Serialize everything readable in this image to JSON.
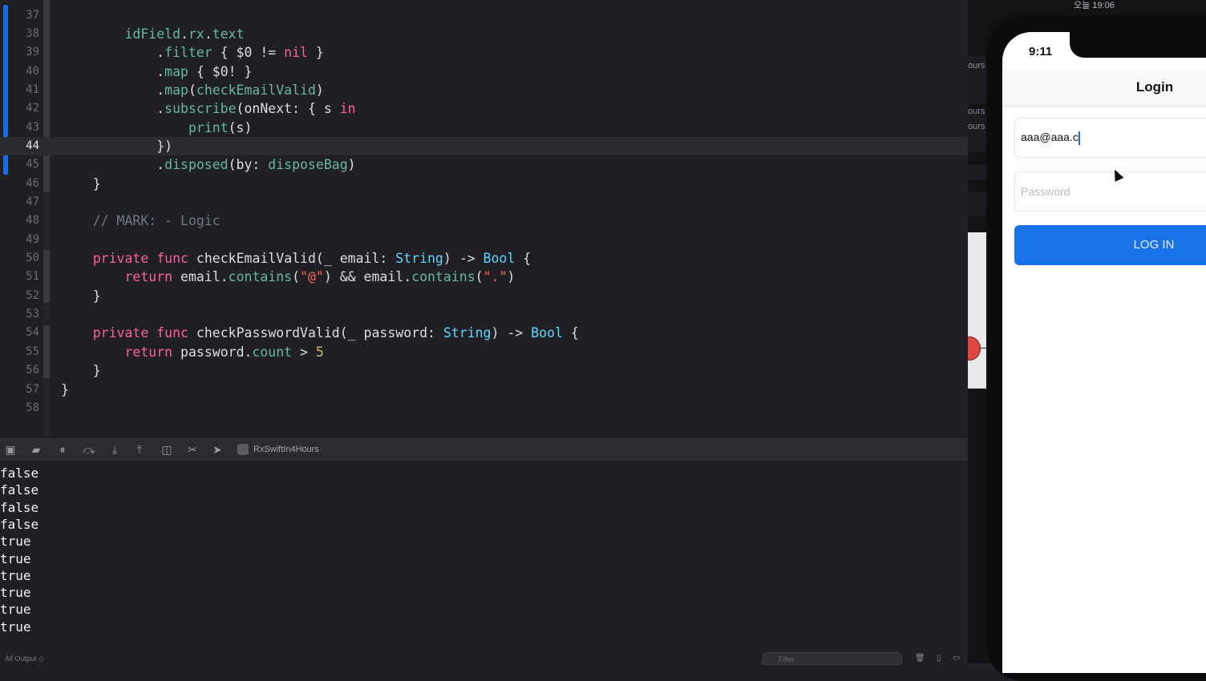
{
  "editor": {
    "lines": [
      {
        "n": "37",
        "tokens": []
      },
      {
        "n": "38",
        "tokens": [
          {
            "t": "        "
          },
          {
            "c": "prop",
            "t": "idField"
          },
          {
            "t": "."
          },
          {
            "c": "prop",
            "t": "rx"
          },
          {
            "t": "."
          },
          {
            "c": "prop",
            "t": "text"
          }
        ]
      },
      {
        "n": "39",
        "tokens": [
          {
            "t": "            ."
          },
          {
            "c": "fn",
            "t": "filter"
          },
          {
            "t": " { $0 != "
          },
          {
            "c": "kw",
            "t": "nil"
          },
          {
            "t": " }"
          }
        ]
      },
      {
        "n": "40",
        "tokens": [
          {
            "t": "            ."
          },
          {
            "c": "fn",
            "t": "map"
          },
          {
            "t": " { $0! }"
          }
        ]
      },
      {
        "n": "41",
        "tokens": [
          {
            "t": "            ."
          },
          {
            "c": "fn",
            "t": "map"
          },
          {
            "t": "("
          },
          {
            "c": "fn",
            "t": "checkEmailValid"
          },
          {
            "t": ")"
          }
        ]
      },
      {
        "n": "42",
        "tokens": [
          {
            "t": "            ."
          },
          {
            "c": "fn",
            "t": "subscribe"
          },
          {
            "t": "(onNext: { s "
          },
          {
            "c": "kw",
            "t": "in"
          }
        ]
      },
      {
        "n": "43",
        "tokens": [
          {
            "t": "                "
          },
          {
            "c": "fn",
            "t": "print"
          },
          {
            "t": "(s)"
          }
        ]
      },
      {
        "n": "44",
        "current": true,
        "tokens": [
          {
            "t": "            })"
          }
        ]
      },
      {
        "n": "45",
        "tokens": [
          {
            "t": "            ."
          },
          {
            "c": "fn",
            "t": "disposed"
          },
          {
            "t": "(by: "
          },
          {
            "c": "prop",
            "t": "disposeBag"
          },
          {
            "t": ")"
          }
        ]
      },
      {
        "n": "46",
        "tokens": [
          {
            "t": "    }"
          }
        ]
      },
      {
        "n": "47",
        "tokens": []
      },
      {
        "n": "48",
        "tokens": [
          {
            "t": "    "
          },
          {
            "c": "cmt",
            "t": "// MARK: - Logic"
          }
        ]
      },
      {
        "n": "49",
        "tokens": []
      },
      {
        "n": "50",
        "tokens": [
          {
            "t": "    "
          },
          {
            "c": "kw",
            "t": "private"
          },
          {
            "t": " "
          },
          {
            "c": "kw",
            "t": "func"
          },
          {
            "t": " checkEmailValid(_ email: "
          },
          {
            "c": "ty",
            "t": "String"
          },
          {
            "t": ") -> "
          },
          {
            "c": "ty",
            "t": "Bool"
          },
          {
            "t": " {"
          }
        ]
      },
      {
        "n": "51",
        "tokens": [
          {
            "t": "        "
          },
          {
            "c": "kw",
            "t": "return"
          },
          {
            "t": " email."
          },
          {
            "c": "fn",
            "t": "contains"
          },
          {
            "t": "("
          },
          {
            "c": "str",
            "t": "\"@\""
          },
          {
            "t": ") && email."
          },
          {
            "c": "fn",
            "t": "contains"
          },
          {
            "t": "("
          },
          {
            "c": "str",
            "t": "\".\""
          },
          {
            "t": ")"
          }
        ]
      },
      {
        "n": "52",
        "tokens": [
          {
            "t": "    }"
          }
        ]
      },
      {
        "n": "53",
        "tokens": []
      },
      {
        "n": "54",
        "tokens": [
          {
            "t": "    "
          },
          {
            "c": "kw",
            "t": "private"
          },
          {
            "t": " "
          },
          {
            "c": "kw",
            "t": "func"
          },
          {
            "t": " checkPasswordValid(_ password: "
          },
          {
            "c": "ty",
            "t": "String"
          },
          {
            "t": ") -> "
          },
          {
            "c": "ty",
            "t": "Bool"
          },
          {
            "t": " {"
          }
        ]
      },
      {
        "n": "55",
        "tokens": [
          {
            "t": "        "
          },
          {
            "c": "kw",
            "t": "return"
          },
          {
            "t": " password."
          },
          {
            "c": "prop",
            "t": "count"
          },
          {
            "t": " > "
          },
          {
            "c": "num",
            "t": "5"
          }
        ]
      },
      {
        "n": "56",
        "tokens": [
          {
            "t": "    }"
          }
        ]
      },
      {
        "n": "57",
        "tokens": [
          {
            "t": "}"
          }
        ]
      },
      {
        "n": "58",
        "tokens": []
      }
    ]
  },
  "debug": {
    "scheme": "RxSwiftIn4Hours"
  },
  "console": {
    "output": [
      "false",
      "false",
      "false",
      "false",
      "true",
      "true",
      "true",
      "true",
      "true",
      "true"
    ],
    "footer_label": "All Output ◇",
    "filter_placeholder": "Filter"
  },
  "background": {
    "clock": "오늘 19:06",
    "snippets": [
      "ours",
      "ours",
      "ours"
    ]
  },
  "simulator": {
    "time": "9:11",
    "nav_title": "Login",
    "email_value": "aaa@aaa.c",
    "password_placeholder": "Password",
    "login_button": "LOG IN"
  },
  "colors": {
    "keyword": "#fc5fa3",
    "function": "#67b7a4",
    "type": "#5dd8ff",
    "string": "#fc6a5d",
    "number": "#d0bf69",
    "comment": "#6c7986",
    "login_button": "#1a72e8"
  }
}
